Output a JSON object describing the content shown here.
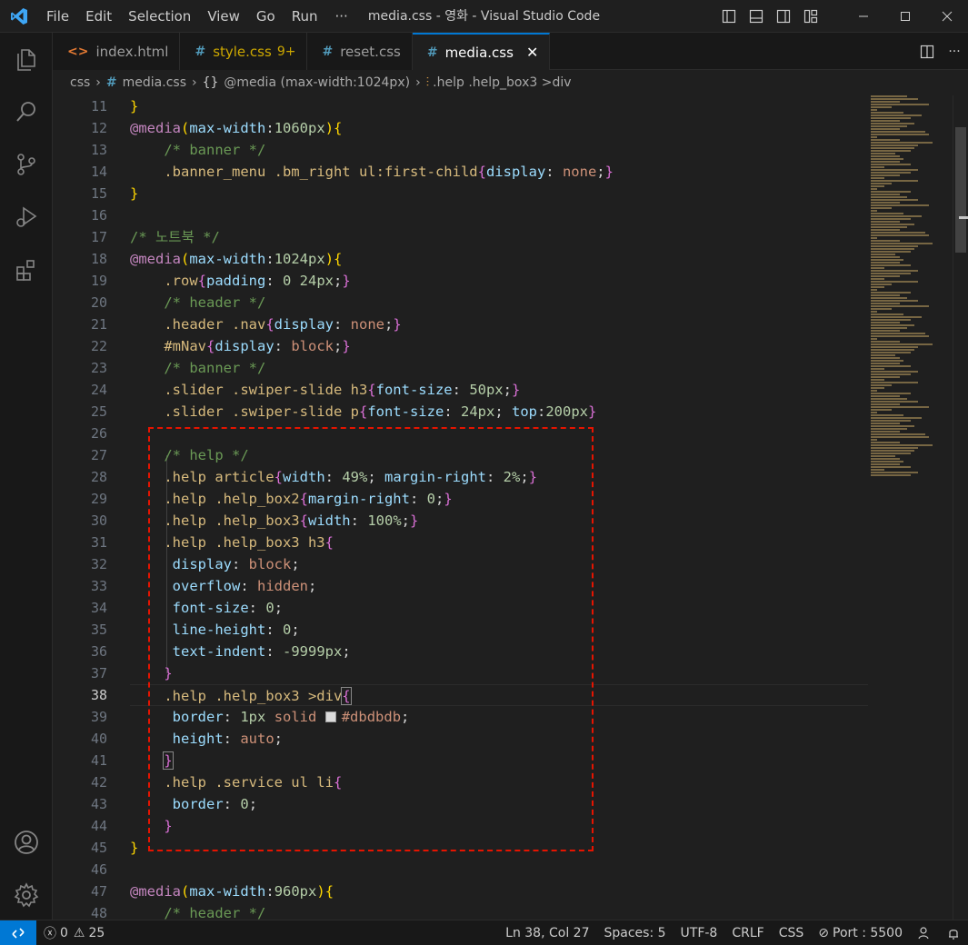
{
  "menu": [
    "File",
    "Edit",
    "Selection",
    "View",
    "Go",
    "Run"
  ],
  "menu_more": "···",
  "window_title": "media.css - 영화 - Visual Studio Code",
  "tabs": [
    {
      "icon": "<>",
      "label": "index.html",
      "modified": "",
      "active": false,
      "warn": false
    },
    {
      "icon": "#",
      "label": "style.css",
      "modified": "9+",
      "active": false,
      "warn": true
    },
    {
      "icon": "#",
      "label": "reset.css",
      "modified": "",
      "active": false,
      "warn": false
    },
    {
      "icon": "#",
      "label": "media.css",
      "modified": "",
      "active": true,
      "warn": false
    }
  ],
  "tab_close": "✕",
  "breadcrumb": {
    "folder": "css",
    "file": "media.css",
    "scope": "@media (max-width:1024px)",
    "symbol": ".help .help_box3 >div"
  },
  "editor": {
    "active_line": 38,
    "lines": [
      {
        "n": "11",
        "html": "<span class='br1'>}</span>"
      },
      {
        "n": "12",
        "html": "<span class='kw'>@media</span><span class='br1'>(</span><span class='prop'>max-width</span><span class='plain'>:</span><span class='num'>1060px</span><span class='br1'>)</span><span class='br1'>{</span>"
      },
      {
        "n": "13",
        "html": "    <span class='com'>/* banner */</span>"
      },
      {
        "n": "14",
        "html": "    <span class='sel'>.banner_menu .bm_right ul:first-child</span><span class='br2'>{</span><span class='prop'>display</span><span class='plain'>: </span><span class='val'>none</span><span class='plain'>;</span><span class='br2'>}</span>"
      },
      {
        "n": "15",
        "html": "<span class='br1'>}</span>"
      },
      {
        "n": "16",
        "html": ""
      },
      {
        "n": "17",
        "html": "<span class='com'>/* 노트북 */</span>"
      },
      {
        "n": "18",
        "html": "<span class='kw'>@media</span><span class='br1'>(</span><span class='prop'>max-width</span><span class='plain'>:</span><span class='num'>1024px</span><span class='br1'>)</span><span class='br1'>{</span>"
      },
      {
        "n": "19",
        "html": "    <span class='sel'>.row</span><span class='br2'>{</span><span class='prop'>padding</span><span class='plain'>: </span><span class='num'>0 24px</span><span class='plain'>;</span><span class='br2'>}</span>"
      },
      {
        "n": "20",
        "html": "    <span class='com'>/* header */</span>"
      },
      {
        "n": "21",
        "html": "    <span class='sel'>.header .nav</span><span class='br2'>{</span><span class='prop'>display</span><span class='plain'>: </span><span class='val'>none</span><span class='plain'>;</span><span class='br2'>}</span>"
      },
      {
        "n": "22",
        "html": "    <span class='sel'>#mNav</span><span class='br2'>{</span><span class='prop'>display</span><span class='plain'>: </span><span class='val'>block</span><span class='plain'>;</span><span class='br2'>}</span>"
      },
      {
        "n": "23",
        "html": "    <span class='com'>/* banner */</span>"
      },
      {
        "n": "24",
        "html": "    <span class='sel'>.slider .swiper-slide h3</span><span class='br2'>{</span><span class='prop'>font-size</span><span class='plain'>: </span><span class='num'>50px</span><span class='plain'>;</span><span class='br2'>}</span>"
      },
      {
        "n": "25",
        "html": "    <span class='sel'>.slider .swiper-slide p</span><span class='br2'>{</span><span class='prop'>font-size</span><span class='plain'>: </span><span class='num'>24px</span><span class='plain'>; </span><span class='prop'>top</span><span class='plain'>:</span><span class='num'>200px</span><span class='br2'>}</span>"
      },
      {
        "n": "26",
        "html": ""
      },
      {
        "n": "27",
        "html": "    <span class='com'>/* help */</span>"
      },
      {
        "n": "28",
        "html": "    <span class='sel'>.help article</span><span class='br2'>{</span><span class='prop'>width</span><span class='plain'>: </span><span class='num'>49%</span><span class='plain'>; </span><span class='prop'>margin-right</span><span class='plain'>: </span><span class='num'>2%</span><span class='plain'>;</span><span class='br2'>}</span>"
      },
      {
        "n": "29",
        "html": "    <span class='sel'>.help .help_box2</span><span class='br2'>{</span><span class='prop'>margin-right</span><span class='plain'>: </span><span class='num'>0</span><span class='plain'>;</span><span class='br2'>}</span>"
      },
      {
        "n": "30",
        "html": "    <span class='sel'>.help .help_box3</span><span class='br2'>{</span><span class='prop'>width</span><span class='plain'>: </span><span class='num'>100%</span><span class='plain'>;</span><span class='br2'>}</span>"
      },
      {
        "n": "31",
        "html": "    <span class='sel'>.help .help_box3 h3</span><span class='br2'>{</span>"
      },
      {
        "n": "32",
        "html": "     <span class='prop'>display</span><span class='plain'>: </span><span class='val'>block</span><span class='plain'>;</span>"
      },
      {
        "n": "33",
        "html": "     <span class='prop'>overflow</span><span class='plain'>: </span><span class='val'>hidden</span><span class='plain'>;</span>"
      },
      {
        "n": "34",
        "html": "     <span class='prop'>font-size</span><span class='plain'>: </span><span class='num'>0</span><span class='plain'>;</span>"
      },
      {
        "n": "35",
        "html": "     <span class='prop'>line-height</span><span class='plain'>: </span><span class='num'>0</span><span class='plain'>;</span>"
      },
      {
        "n": "36",
        "html": "     <span class='prop'>text-indent</span><span class='plain'>: </span><span class='num'>-9999px</span><span class='plain'>;</span>"
      },
      {
        "n": "37",
        "html": "    <span class='br2'>}</span>"
      },
      {
        "n": "38",
        "html": "    <span class='sel'>.help .help_box3 &gt;div</span><span class='br2' style='outline:1px solid #888'>{</span>"
      },
      {
        "n": "39",
        "html": "     <span class='prop'>border</span><span class='plain'>: </span><span class='num'>1px</span><span class='plain'> </span><span class='val'>solid</span><span class='plain'> </span><span class='swatch'></span><span class='val'>#dbdbdb</span><span class='plain'>;</span>"
      },
      {
        "n": "40",
        "html": "     <span class='prop'>height</span><span class='plain'>: </span><span class='val'>auto</span><span class='plain'>;</span>"
      },
      {
        "n": "41",
        "html": "    <span class='br2' style='outline:1px solid #888'>}</span>"
      },
      {
        "n": "42",
        "html": "    <span class='sel'>.help .service ul li</span><span class='br2'>{</span>"
      },
      {
        "n": "43",
        "html": "     <span class='prop'>border</span><span class='plain'>: </span><span class='num'>0</span><span class='plain'>;</span>"
      },
      {
        "n": "44",
        "html": "    <span class='br2'>}</span>"
      },
      {
        "n": "45",
        "html": "<span class='br1'>}</span>"
      },
      {
        "n": "46",
        "html": ""
      },
      {
        "n": "47",
        "html": "<span class='kw'>@media</span><span class='br1'>(</span><span class='prop'>max-width</span><span class='plain'>:</span><span class='num'>960px</span><span class='br1'>)</span><span class='br1'>{</span>"
      },
      {
        "n": "48",
        "html": "    <span class='com'>/* header */</span>"
      }
    ]
  },
  "status": {
    "errors": "0",
    "warnings": "25",
    "position": "Ln 38, Col 27",
    "spaces": "Spaces: 5",
    "encoding": "UTF-8",
    "eol": "CRLF",
    "language": "CSS",
    "port": "Port : 5500"
  },
  "colors": {
    "accent": "#0078d4",
    "highlight_box": "#e51400"
  }
}
